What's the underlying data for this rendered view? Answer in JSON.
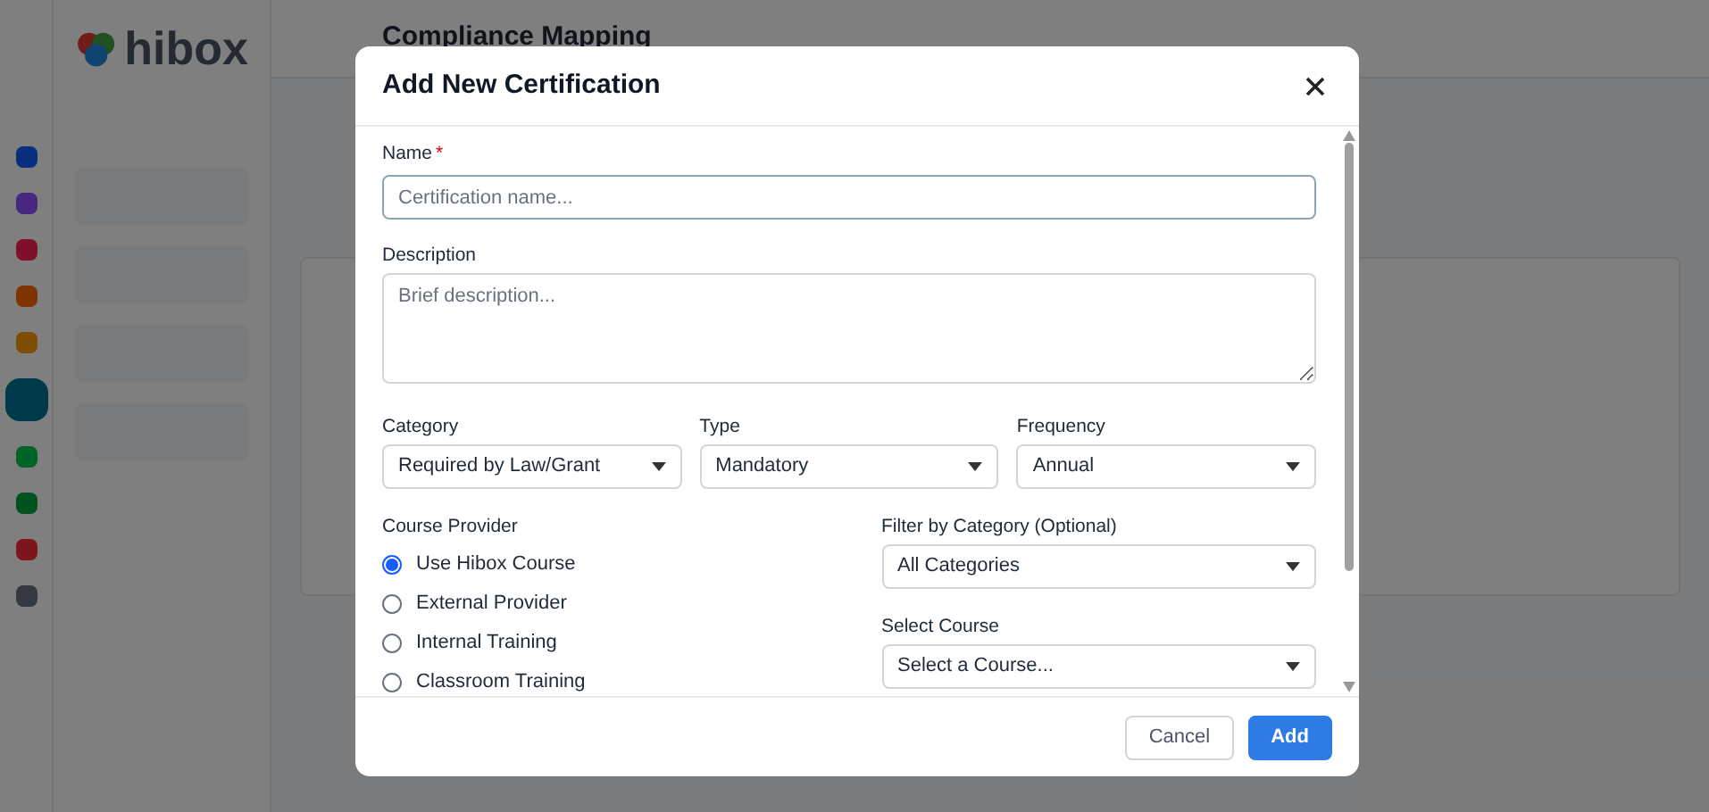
{
  "background": {
    "logo": "hibox",
    "page_title": "Compliance Mapping"
  },
  "dialog": {
    "title": "Add New Certification",
    "name_field": {
      "label": "Name",
      "required_mark": "*",
      "placeholder": "Certification name..."
    },
    "description_field": {
      "label": "Description",
      "placeholder": "Brief description..."
    },
    "selects": [
      {
        "label": "Category",
        "value": "Required by Law/Grant"
      },
      {
        "label": "Type",
        "value": "Mandatory"
      },
      {
        "label": "Frequency",
        "value": "Annual"
      }
    ],
    "course_provider": {
      "label": "Course Provider",
      "options": [
        {
          "label": "Use Hibox Course",
          "selected": true
        },
        {
          "label": "External Provider",
          "selected": false
        },
        {
          "label": "Internal Training",
          "selected": false
        },
        {
          "label": "Classroom Training",
          "selected": false
        }
      ]
    },
    "course_selects": [
      {
        "label": "Filter by Category (Optional)",
        "value": "All Categories"
      },
      {
        "label": "Select Course",
        "value": "Select a Course..."
      }
    ],
    "buttons": [
      {
        "label": "Cancel",
        "kind": "secondary"
      },
      {
        "label": "Add",
        "kind": "primary"
      }
    ]
  }
}
